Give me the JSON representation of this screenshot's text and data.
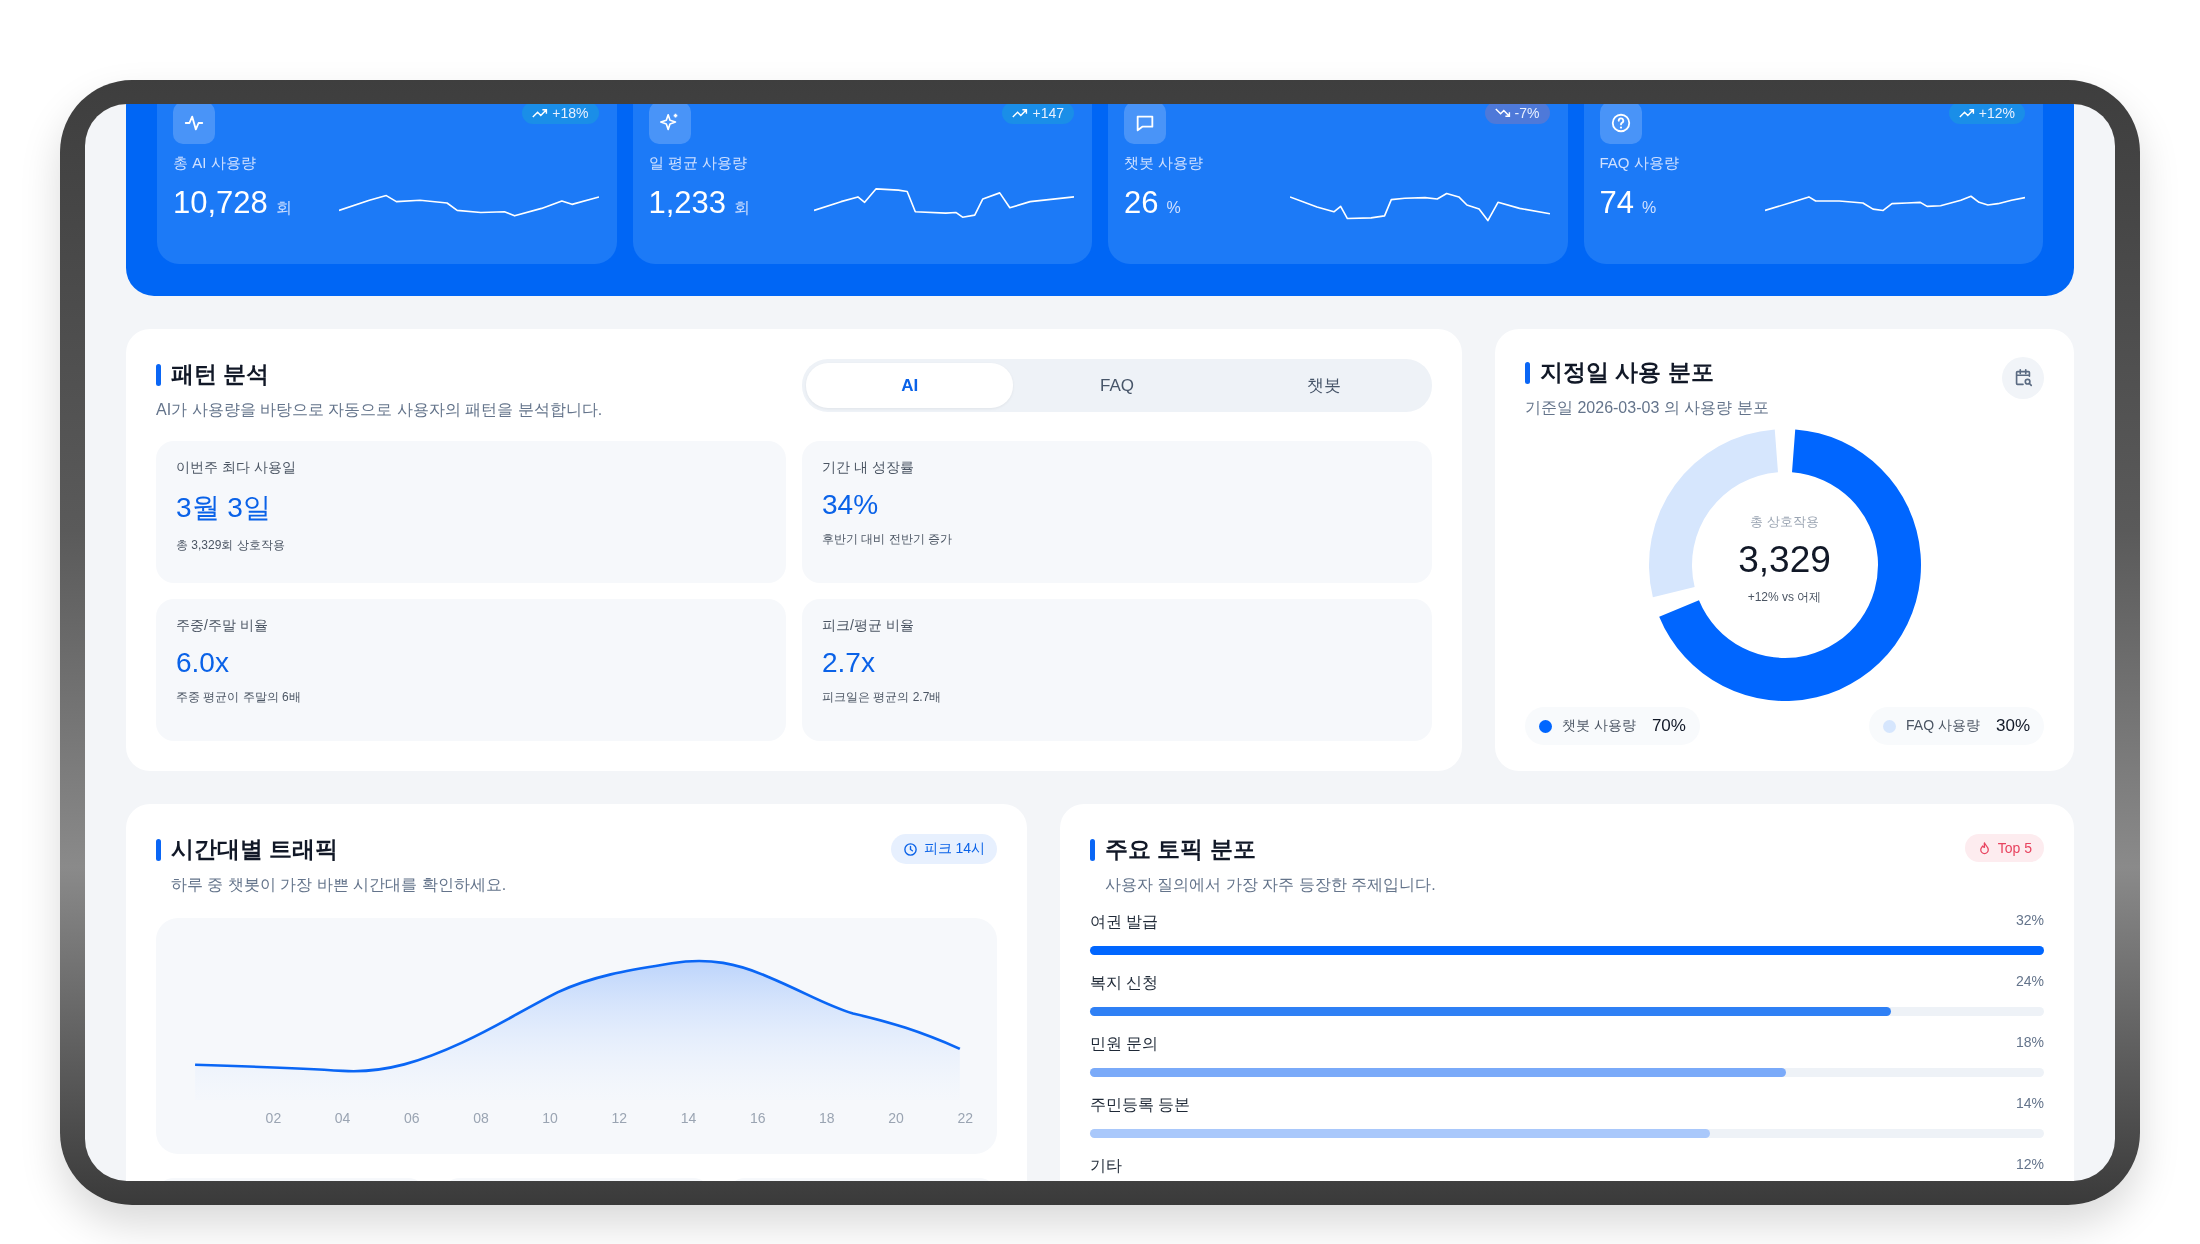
{
  "kpi_cards": [
    {
      "label": "총 AI 사용량",
      "value": "10,728",
      "unit": "회",
      "change": "+18%",
      "kind": "up"
    },
    {
      "label": "일 평균 사용량",
      "value": "1,233",
      "unit": "회",
      "change": "+147",
      "kind": "up"
    },
    {
      "label": "챗봇 사용량",
      "value": "26",
      "unit": "%",
      "change": "-7%",
      "kind": "down"
    },
    {
      "label": "FAQ 사용량",
      "value": "74",
      "unit": "%",
      "change": "+12%",
      "kind": "up"
    }
  ],
  "pattern": {
    "title": "패턴 분석",
    "subtitle": "AI가 사용량을 바탕으로 자동으로 사용자의 패턴을 분석합니다.",
    "tabs": [
      {
        "label": "AI",
        "selected": true
      },
      {
        "label": "FAQ",
        "selected": false
      },
      {
        "label": "챗봇",
        "selected": false
      }
    ],
    "stats": [
      {
        "label": "이번주 최다 사용일",
        "value": "3월 3일",
        "note": "총 3,329회 상호작용"
      },
      {
        "label": "기간 내 성장률",
        "value": "34%",
        "note": "후반기 대비 전반기 증가"
      },
      {
        "label": "주중/주말 비율",
        "value": "6.0x",
        "note": "주중 평균이 주말의 6배"
      },
      {
        "label": "피크/평균 비율",
        "value": "2.7x",
        "note": "피크일은 평균의 2.7배"
      }
    ]
  },
  "distribution": {
    "title": "지정일 사용 분포",
    "subtitle": "기준일 2026-03-03 의 사용량 분포",
    "center_label": "총 상호작용",
    "center_value": "3,329",
    "center_note": "+12% vs 어제",
    "chart_data": {
      "type": "donut",
      "categories": [
        "챗봇 사용량",
        "FAQ 사용량"
      ],
      "values": [
        70,
        30
      ]
    },
    "legend": [
      {
        "value": "70%",
        "color": "#0066ff"
      },
      {
        "value": "30%",
        "color": "#d6e6fd"
      }
    ]
  },
  "traffic": {
    "title": "시간대별 트래픽",
    "subtitle": "하루 중 챗봇이 가장 바쁜 시간대를 확인하세요.",
    "badge": "피크 14시",
    "x_labels": [
      "02",
      "04",
      "06",
      "08",
      "10",
      "12",
      "14",
      "16",
      "18",
      "20",
      "22"
    ]
  },
  "topics": {
    "title": "주요 토픽 분포",
    "subtitle": "사용자 질의에서 가장 자주 등장한 주제입니다.",
    "badge": "Top 5",
    "items": [
      {
        "label": "여권 발급",
        "value": "32%",
        "level": 1.0,
        "color": "#0066ff"
      },
      {
        "label": "복지 신청",
        "value": "24%",
        "level": 0.84,
        "color": "#2f80f5"
      },
      {
        "label": "민원 문의",
        "value": "18%",
        "level": 0.73,
        "color": "#7aaaf9"
      },
      {
        "label": "주민등록 등본",
        "value": "14%",
        "level": 0.65,
        "color": "#a9c8fb"
      },
      {
        "label": "기타",
        "value": "12%"
      }
    ]
  }
}
